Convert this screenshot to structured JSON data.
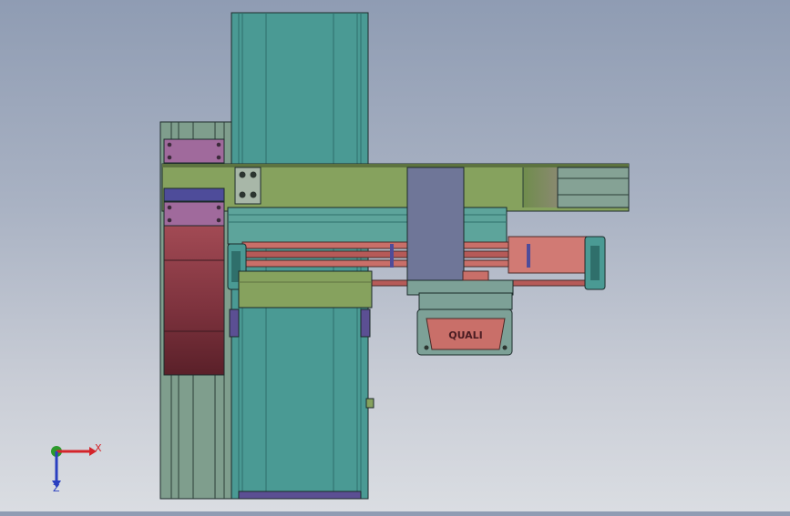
{
  "viewport": {
    "description_label": "",
    "colors": {
      "rail_teal": "#4a9a94",
      "rail_teal_dark": "#2f6f6b",
      "beam_olive": "#86a25e",
      "beam_olive_dark": "#5d7340",
      "rail_green_gray": "#7f9e8d",
      "slide_blue_gray": "#6f7698",
      "block_maroon": "#8e3f4a",
      "plate_purple": "#a06a9c",
      "bar_salmon": "#c96f69",
      "bracket_indigo": "#4e4c9a",
      "outline": "#1c2a2a"
    },
    "part_marking": "QUALI"
  },
  "triad": {
    "x_label": "X",
    "z_label": "Z",
    "x_color": "#d4242a",
    "y_color": "#2c9a2c",
    "z_color": "#2a3fc0"
  }
}
